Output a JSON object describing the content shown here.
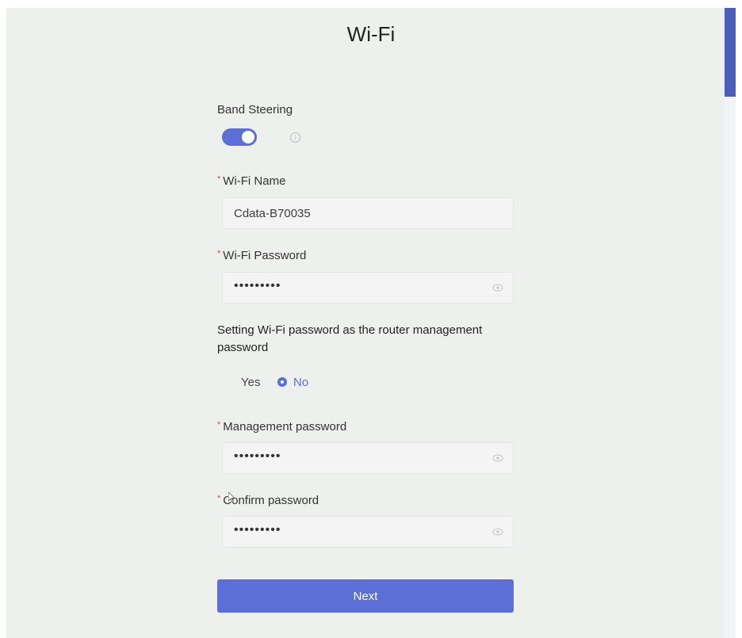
{
  "page": {
    "title": "Wi-Fi"
  },
  "band_steering": {
    "label": "Band Steering",
    "enabled": true,
    "info_icon": "info-circle-icon"
  },
  "wifi_name": {
    "label": "Wi-Fi Name",
    "value": "Cdata-B70035"
  },
  "wifi_password": {
    "label": "Wi-Fi Password",
    "masked_value": "•••••••••",
    "toggle_icon": "eye-icon"
  },
  "router_management": {
    "description": "Setting Wi-Fi password as the router management password",
    "options": [
      {
        "label": "Yes",
        "selected": false
      },
      {
        "label": "No",
        "selected": true
      }
    ]
  },
  "management_password": {
    "label": "Management password",
    "masked_value": "•••••••••",
    "toggle_icon": "eye-icon"
  },
  "confirm_password": {
    "label": "Confirm password",
    "masked_value": "•••••••••",
    "toggle_icon": "eye-icon"
  },
  "next_button": {
    "label": "Next"
  },
  "colors": {
    "accent": "#5b6fd6",
    "required": "#e04545",
    "scrollbar": "#4c5fb8"
  }
}
